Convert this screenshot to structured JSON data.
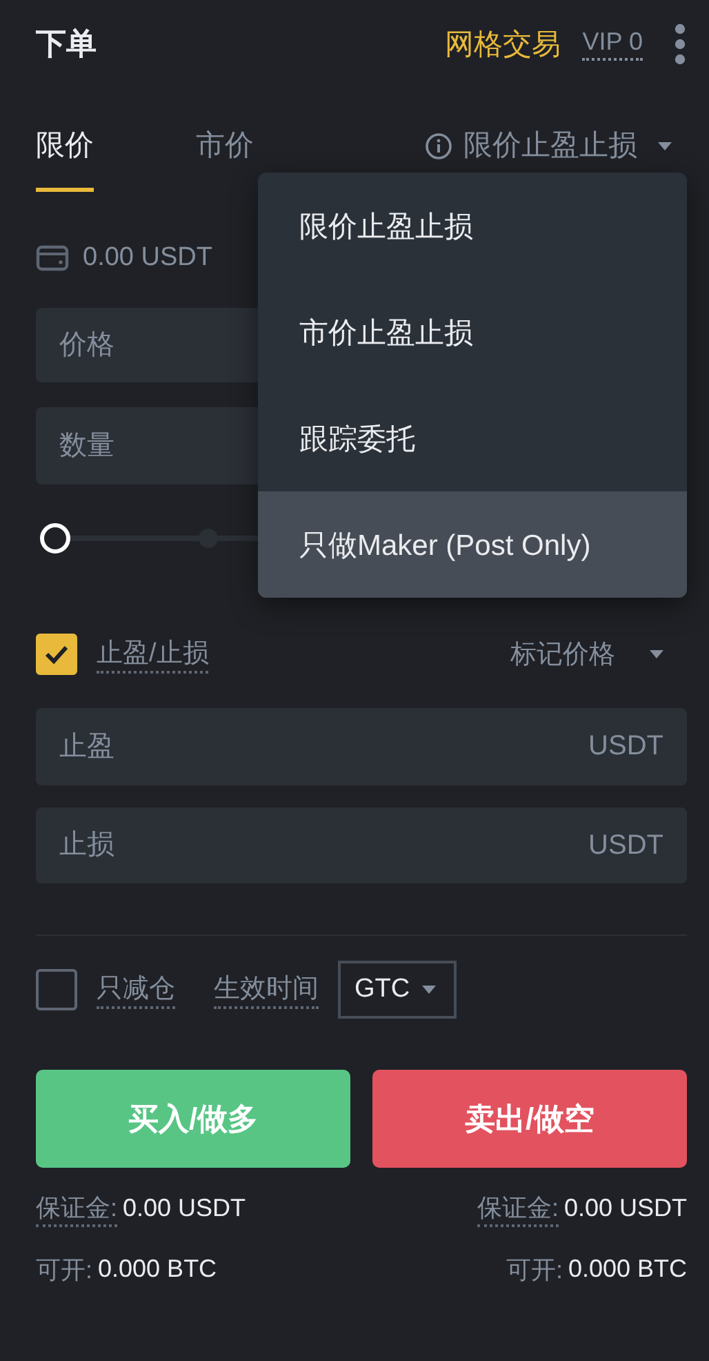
{
  "header": {
    "title": "下单",
    "grid_link": "网格交易",
    "vip": "VIP 0"
  },
  "tabs": [
    {
      "label": "限价",
      "selected": true,
      "kind": "plain"
    },
    {
      "label": "市价",
      "selected": false,
      "kind": "plain"
    },
    {
      "label": "限价止盈止损",
      "selected": false,
      "kind": "dropdown"
    }
  ],
  "balance": "0.00 USDT",
  "fields": [
    {
      "placeholder": "价格"
    },
    {
      "placeholder": "数量"
    }
  ],
  "slider": {
    "level": 0
  },
  "dropdown_menu": [
    {
      "label": "限价止盈止损",
      "highlighted": false
    },
    {
      "label": "市价止盈止损",
      "highlighted": false
    },
    {
      "label": "跟踪委托",
      "highlighted": false
    },
    {
      "label": "只做Maker (Post Only)",
      "highlighted": true
    }
  ],
  "tp_sl": {
    "label": "止盈/止损",
    "checked": true,
    "price_type": "标记价格",
    "fields": [
      {
        "placeholder": "止盈",
        "unit": "USDT"
      },
      {
        "placeholder": "止损",
        "unit": "USDT"
      }
    ]
  },
  "reduce_only": {
    "label": "只减仓",
    "checked": false
  },
  "time_in_force": {
    "label": "生效时间",
    "value": "GTC"
  },
  "actions": [
    {
      "label": "买入/做多",
      "kind": "buy",
      "margin_label": "保证金:",
      "margin": "0.00 USDT",
      "max_label": "可开:",
      "max": "0.000 BTC"
    },
    {
      "label": "卖出/做空",
      "kind": "sell",
      "margin_label": "保证金:",
      "margin": "0.00 USDT",
      "max_label": "可开:",
      "max": "0.000 BTC"
    }
  ]
}
